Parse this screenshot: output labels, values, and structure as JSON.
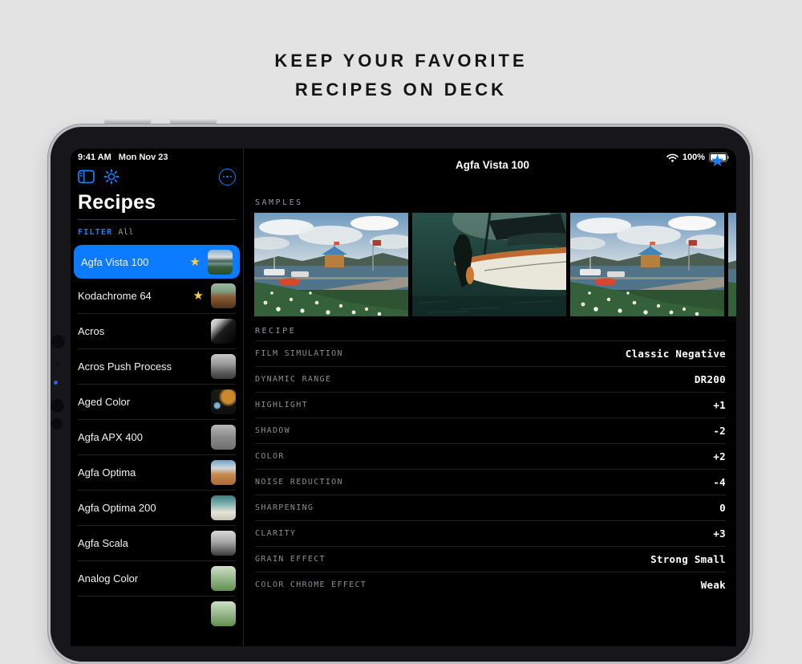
{
  "heading": {
    "line1": "KEEP YOUR FAVORITE",
    "line2": "RECIPES ON DECK"
  },
  "status_bar": {
    "time": "9:41 AM",
    "date": "Mon Nov 23",
    "battery_percent": "100%",
    "wifi_icon": "wifi-icon",
    "battery_icon": "battery-icon"
  },
  "sidebar": {
    "toolbar": {
      "sidebar_toggle_icon": "sidebar-toggle-icon",
      "settings_icon": "gear-icon",
      "more_icon": "ellipsis-circle-icon"
    },
    "title": "Recipes",
    "filter": {
      "label": "FILTER",
      "value": "All"
    },
    "star_icon": "★",
    "items": [
      {
        "label": "Agfa Vista 100",
        "starred": true,
        "selected": true
      },
      {
        "label": "Kodachrome 64",
        "starred": true
      },
      {
        "label": "Acros"
      },
      {
        "label": "Acros Push Process"
      },
      {
        "label": "Aged Color"
      },
      {
        "label": "Agfa APX 400"
      },
      {
        "label": "Agfa Optima"
      },
      {
        "label": "Agfa Optima 200"
      },
      {
        "label": "Agfa Scala"
      },
      {
        "label": "Analog Color"
      },
      {
        "label": ""
      }
    ]
  },
  "detail": {
    "title": "Agfa Vista 100",
    "favorite_icon": "★",
    "samples_label": "SAMPLES",
    "recipe_label": "RECIPE",
    "settings": [
      {
        "label": "FILM SIMULATION",
        "value": "Classic Negative"
      },
      {
        "label": "DYNAMIC RANGE",
        "value": "DR200"
      },
      {
        "label": "HIGHLIGHT",
        "value": "+1"
      },
      {
        "label": "SHADOW",
        "value": "-2"
      },
      {
        "label": "COLOR",
        "value": "+2"
      },
      {
        "label": "NOISE REDUCTION",
        "value": "-4"
      },
      {
        "label": "SHARPENING",
        "value": "0"
      },
      {
        "label": "CLARITY",
        "value": "+3"
      },
      {
        "label": "GRAIN EFFECT",
        "value": "Strong Small"
      },
      {
        "label": "COLOR CHROME EFFECT",
        "value": "Weak"
      }
    ]
  },
  "colors": {
    "accent": "#0a84ff",
    "selected_row": "#0b7bff",
    "star_yellow": "#f7ce46",
    "page_bg": "#e3e3e3",
    "screen_bg": "#000000",
    "label_gray": "#8e8e93"
  }
}
